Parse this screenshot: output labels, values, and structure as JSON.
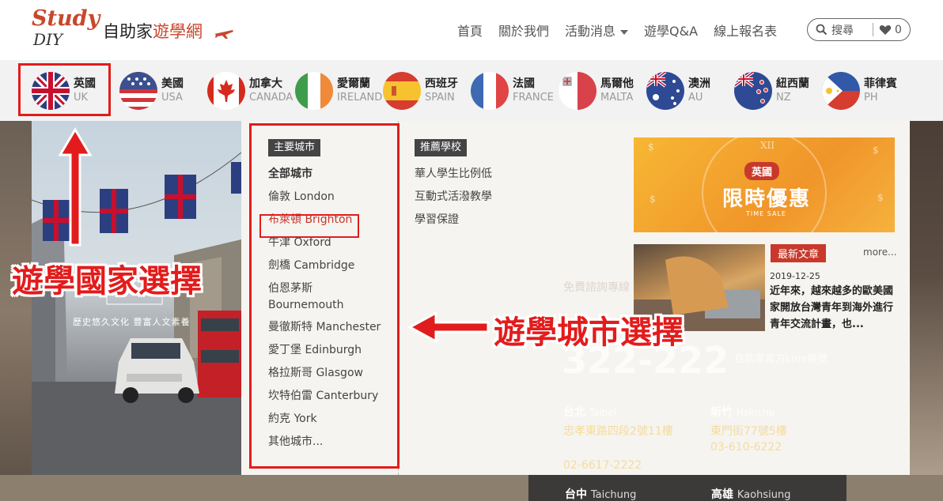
{
  "header": {
    "logo_study": "Study",
    "logo_diy": "DIY",
    "logo_cn_black": "自助家",
    "logo_cn_red": "遊學網",
    "nav": [
      "首頁",
      "關於我們",
      "活動消息",
      "遊學Q&A",
      "線上報名表"
    ],
    "search_label": "搜尋",
    "favorites_count": "0"
  },
  "countries": [
    {
      "cn": "英國",
      "en": "UK",
      "icon": "uk-flag-icon"
    },
    {
      "cn": "美國",
      "en": "USA",
      "icon": "usa-flag-icon"
    },
    {
      "cn": "加拿大",
      "en": "CANADA",
      "icon": "canada-flag-icon"
    },
    {
      "cn": "愛爾蘭",
      "en": "IRELAND",
      "icon": "ireland-flag-icon"
    },
    {
      "cn": "西班牙",
      "en": "SPAIN",
      "icon": "spain-flag-icon"
    },
    {
      "cn": "法國",
      "en": "FRANCE",
      "icon": "france-flag-icon"
    },
    {
      "cn": "馬爾他",
      "en": "MALTA",
      "icon": "malta-flag-icon"
    },
    {
      "cn": "澳洲",
      "en": "AU",
      "icon": "australia-flag-icon"
    },
    {
      "cn": "紐西蘭",
      "en": "NZ",
      "icon": "new-zealand-flag-icon"
    },
    {
      "cn": "菲律賓",
      "en": "PH",
      "icon": "philippines-flag-icon"
    }
  ],
  "mega": {
    "photo_caption": "歷史悠久文化 豐富人文素養",
    "cities_title": "主要城市",
    "cities": [
      "全部城市",
      "倫敦 London",
      "布萊頓 Brighton",
      "牛津 Oxford",
      "劍橋 Cambridge",
      "伯恩茅斯 Bournemouth",
      "曼徹斯特 Manchester",
      "愛丁堡 Edinburgh",
      "格拉斯哥 Glasgow",
      "坎特伯雷 Canterbury",
      "約克 York",
      "其他城市..."
    ],
    "schools_title": "推薦學校",
    "schools": [
      "華人學生比例低",
      "互動式活潑教學",
      "學習保證"
    ],
    "banner_tag": "英國",
    "banner_title": "限時優惠",
    "banner_sub": "TIME SALE",
    "article_badge": "最新文章",
    "more": "more...",
    "article_date": "2019-12-25",
    "article_text": "近年來，越來越多的歐美國家開放台灣青年到海外進行青年交流計畫，也..."
  },
  "background": {
    "free_consult": "免費諮詢專線",
    "phone": "322-222",
    "line_label": "自助家官方Line帳號",
    "offices": [
      {
        "city": "台北",
        "en": "Taipei",
        "address": "忠孝東路四段2號11樓",
        "phone": "02-6617-2222"
      },
      {
        "city": "新竹",
        "en": "Hsinchu",
        "address": "東門街77號5樓",
        "phone": "03-610-6222"
      },
      {
        "city": "台中",
        "en": "Taichung"
      },
      {
        "city": "高雄",
        "en": "Kaohsiung"
      }
    ]
  },
  "annotations": {
    "country_label": "遊學國家選擇",
    "city_label": "遊學城市選擇"
  },
  "colors": {
    "brand_red": "#c8472b",
    "annotation_red": "#e21c1c",
    "banner_orange": "#f7a532"
  }
}
